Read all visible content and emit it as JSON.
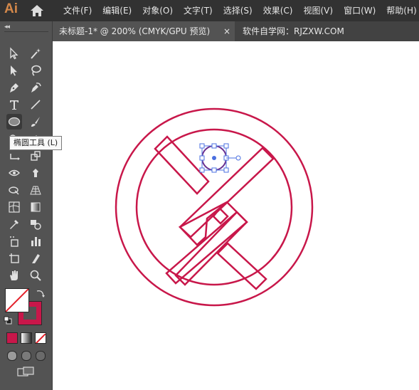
{
  "app": {
    "logo_text": "Ai"
  },
  "menu": {
    "items": [
      "文件(F)",
      "编辑(E)",
      "对象(O)",
      "文字(T)",
      "选择(S)",
      "效果(C)",
      "视图(V)",
      "窗口(W)",
      "帮助(H)"
    ]
  },
  "tabs": {
    "document_title": "未标题-1* @ 200% (CMYK/GPU 预览)",
    "close_glyph": "×",
    "website_label": "软件自学网：RJZXW.COM"
  },
  "panel": {
    "collapse_glyph": "◂◂"
  },
  "tooltip": {
    "text": "椭圆工具 (L)"
  },
  "tools": [
    [
      "selection-tool",
      "direct-selection-tool"
    ],
    [
      "magic-wand-tool",
      "lasso-tool"
    ],
    [
      "pen-tool",
      "curvature-tool"
    ],
    [
      "type-tool",
      "line-segment-tool"
    ],
    [
      "ellipse-tool",
      "paintbrush-tool"
    ],
    [
      "shaper-tool",
      "eraser-tool"
    ],
    [
      "rotate-tool",
      "scale-tool"
    ],
    [
      "width-tool",
      "puppet-warp-tool"
    ],
    [
      "shape-builder-tool",
      "perspective-grid-tool"
    ],
    [
      "mesh-tool",
      "gradient-tool"
    ],
    [
      "eyedropper-tool",
      "blend-tool"
    ],
    [
      "symbol-sprayer-tool",
      "column-graph-tool"
    ],
    [
      "artboard-tool",
      "slice-tool"
    ],
    [
      "hand-tool",
      "zoom-tool"
    ]
  ],
  "colors": {
    "ui_dark": "#323232",
    "ui_panel": "#535353",
    "stroke_color": "#c8174a",
    "selection_blue": "#4a6fe0"
  }
}
